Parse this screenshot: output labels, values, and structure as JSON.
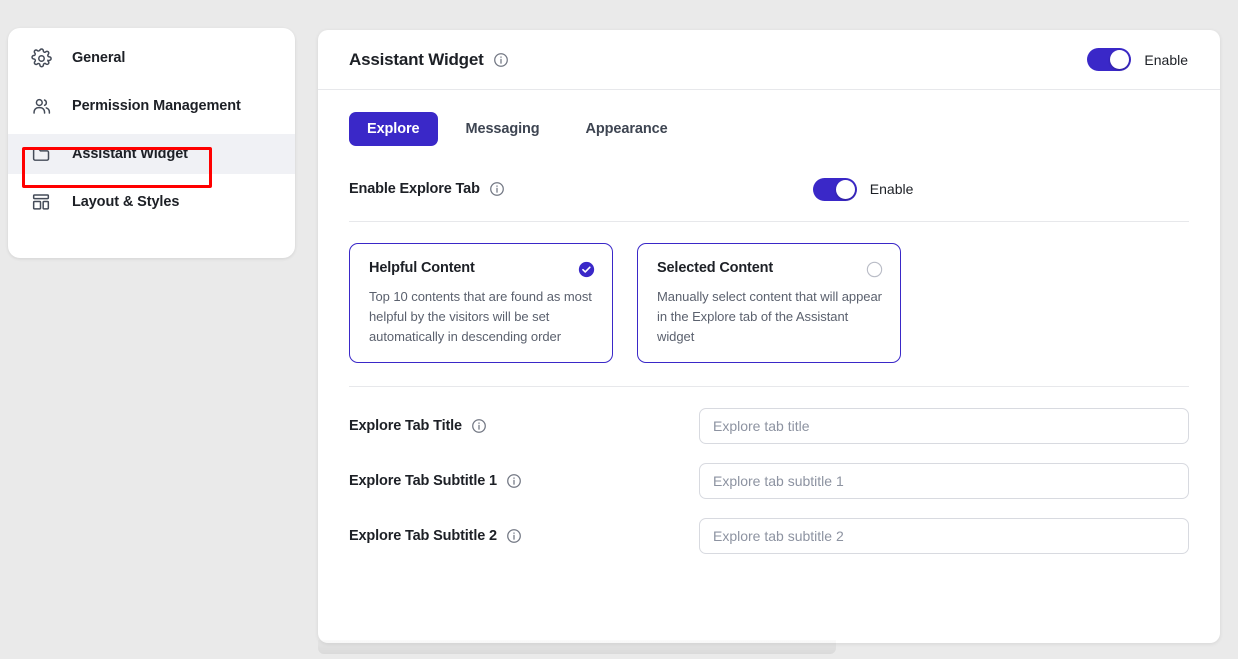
{
  "theme": {
    "accent": "#3a28c8",
    "annotation_highlight": "#ff0000",
    "page_background": "#eaeaea",
    "panel_background": "#ffffff",
    "active_nav_background": "#f0f1f5"
  },
  "sidebar": {
    "items": [
      {
        "label": "General",
        "icon": "gear-icon",
        "active": false
      },
      {
        "label": "Permission Management",
        "icon": "users-icon",
        "active": false
      },
      {
        "label": "Assistant Widget",
        "icon": "folder-icon",
        "active": true
      },
      {
        "label": "Layout & Styles",
        "icon": "layout-icon",
        "active": false
      }
    ]
  },
  "header": {
    "title": "Assistant Widget",
    "info_icon": "info-icon",
    "toggle": {
      "label": "Enable",
      "state": "on"
    }
  },
  "tabs": [
    {
      "label": "Explore",
      "active": true
    },
    {
      "label": "Messaging",
      "active": false
    },
    {
      "label": "Appearance",
      "active": false
    }
  ],
  "explore": {
    "enable_row": {
      "label": "Enable Explore Tab",
      "info_icon": "info-icon",
      "toggle": {
        "label": "Enable",
        "state": "on"
      }
    },
    "content_options": [
      {
        "title": "Helpful Content",
        "description": "Top 10 contents that are found as most helpful by the visitors will be set automatically in descending order",
        "selected": true,
        "indicator_icon": "check-circle-filled-icon"
      },
      {
        "title": "Selected Content",
        "description": "Manually select content that will appear in the Explore tab of the Assistant widget",
        "selected": false,
        "indicator_icon": "radio-empty-icon"
      }
    ],
    "fields": [
      {
        "label": "Explore Tab Title",
        "info_icon": "info-icon",
        "value": "",
        "placeholder": "Explore tab title"
      },
      {
        "label": "Explore Tab Subtitle 1",
        "info_icon": "info-icon",
        "value": "",
        "placeholder": "Explore tab subtitle 1"
      },
      {
        "label": "Explore Tab Subtitle 2",
        "info_icon": "info-icon",
        "value": "",
        "placeholder": "Explore tab subtitle 2"
      }
    ]
  }
}
